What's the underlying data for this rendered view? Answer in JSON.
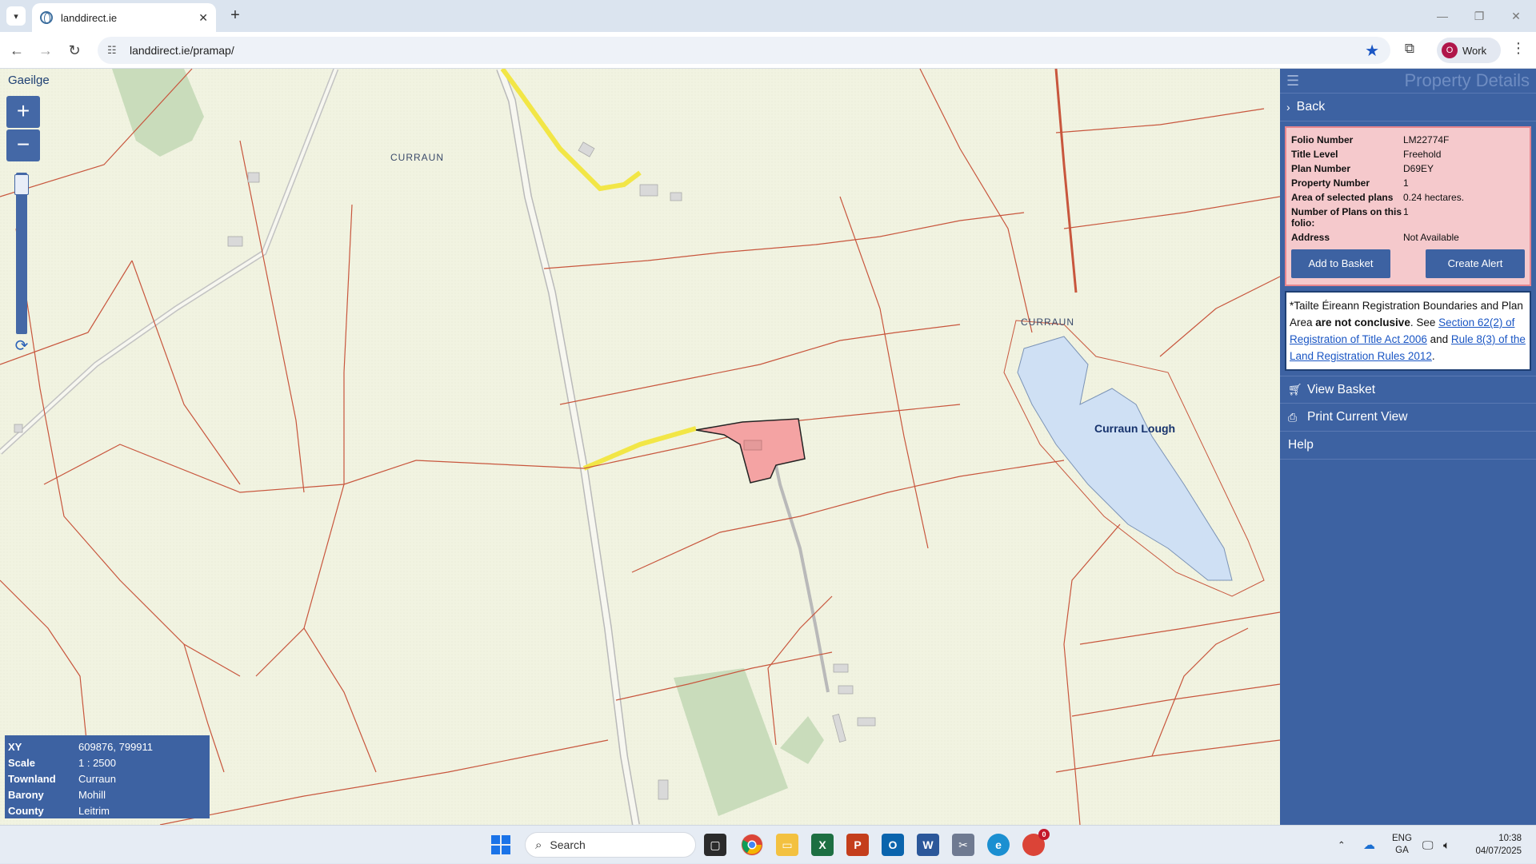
{
  "browser": {
    "tab_title": "landdirect.ie",
    "url": "landdirect.ie/pramap/",
    "profile_initial": "O",
    "profile_label": "Work",
    "icons": {
      "tab_list": "chevron-down-icon",
      "close": "close-icon",
      "new_tab": "plus-icon",
      "back": "back-arrow-icon",
      "forward": "forward-arrow-icon",
      "reload": "reload-icon",
      "site_info": "tune-icon",
      "bookmark": "star-icon",
      "extensions": "puzzle-icon",
      "menu": "kebab-icon"
    }
  },
  "map": {
    "language_link": "Gaeilge",
    "zoom_in": "+",
    "zoom_out": "−",
    "labels": {
      "curraun_north": "CURRAUN",
      "curraun_east": "CURRAUN",
      "lough": "Curraun Lough"
    },
    "colors": {
      "background": "#f2f4e3",
      "boundary": "#c8563d",
      "road": "#b8b8b8",
      "highlight_road": "#f2e646",
      "selected_parcel": "#f4a3a3",
      "lake": "#cfe0f4",
      "forest": "#c9dcbb"
    },
    "info": {
      "xy_label": "XY",
      "xy_value": "609876, 799911",
      "scale_label": "Scale",
      "scale_value": "1 : 2500",
      "townland_label": "Townland",
      "townland_value": "Curraun",
      "barony_label": "Barony",
      "barony_value": "Mohill",
      "county_label": "County",
      "county_value": "Leitrim"
    }
  },
  "panel": {
    "title": "Property Details",
    "back_label": "Back",
    "details": [
      {
        "key": "Folio Number",
        "value": "LM22774F"
      },
      {
        "key": "Title Level",
        "value": "Freehold"
      },
      {
        "key": "Plan Number",
        "value": "D69EY"
      },
      {
        "key": "Property Number",
        "value": "1"
      },
      {
        "key": "Area of selected plans",
        "value": "0.24 hectares."
      },
      {
        "key": "Number of Plans on this folio:",
        "value": "1"
      },
      {
        "key": "Address",
        "value": "Not Available"
      }
    ],
    "add_to_basket": "Add to Basket",
    "create_alert": "Create Alert",
    "notice": {
      "part1": "*Tailte Éireann Registration Boundaries and Plan Area ",
      "bold": "are not conclusive",
      "part2": ". See ",
      "link1": "Section 62(2) of Registration of Title Act 2006",
      "part3": " and ",
      "link2": "Rule 8(3) of the Land Registration Rules 2012",
      "part4": "."
    },
    "view_basket": "View Basket",
    "print_view": "Print Current View",
    "help": "Help"
  },
  "taskbar": {
    "search_placeholder": "Search",
    "lang_top": "ENG",
    "lang_bottom": "GA",
    "time": "10:38",
    "date": "04/07/2025",
    "chrome_badge": "0"
  }
}
